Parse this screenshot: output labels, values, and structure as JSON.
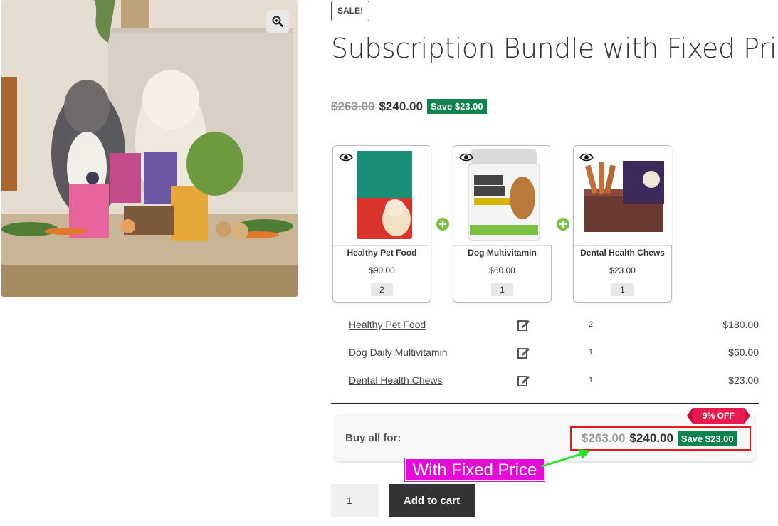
{
  "product": {
    "sale_badge": "SALE!",
    "title": "Subscription Bundle with Fixed Price",
    "price_old": "$263.00",
    "price_new": "$240.00",
    "save": "Save $23.00"
  },
  "bundle_items": [
    {
      "name": "Healthy Pet Food",
      "price": "$90.00",
      "qty": "2"
    },
    {
      "name": "Dog Multivitamin",
      "price": "$60.00",
      "qty": "1"
    },
    {
      "name": "Dental Health Chews",
      "price": "$23.00",
      "qty": "1"
    }
  ],
  "line_items": [
    {
      "name": "Healthy Pet Food",
      "qty": "2",
      "total": "$180.00"
    },
    {
      "name": "Dog Daily Multivitamin",
      "qty": "1",
      "total": "$60.00"
    },
    {
      "name": "Dental Health Chews",
      "qty": "1",
      "total": "$23.00"
    }
  ],
  "buy_all": {
    "label": "Buy all for:",
    "discount_badge": "9% OFF",
    "price_old": "$263.00",
    "price_new": "$240.00",
    "save": "Save $23.00"
  },
  "annotation": "With Fixed Price",
  "cart": {
    "quantity": "1",
    "add_label": "Add to cart"
  },
  "colors": {
    "save_green": "#0f834d",
    "plus_green": "#7ac142",
    "discount_red": "#e8194f",
    "highlight_red": "#e21b23",
    "annotation_magenta": "#e50cd8",
    "button_dark": "#333333"
  }
}
